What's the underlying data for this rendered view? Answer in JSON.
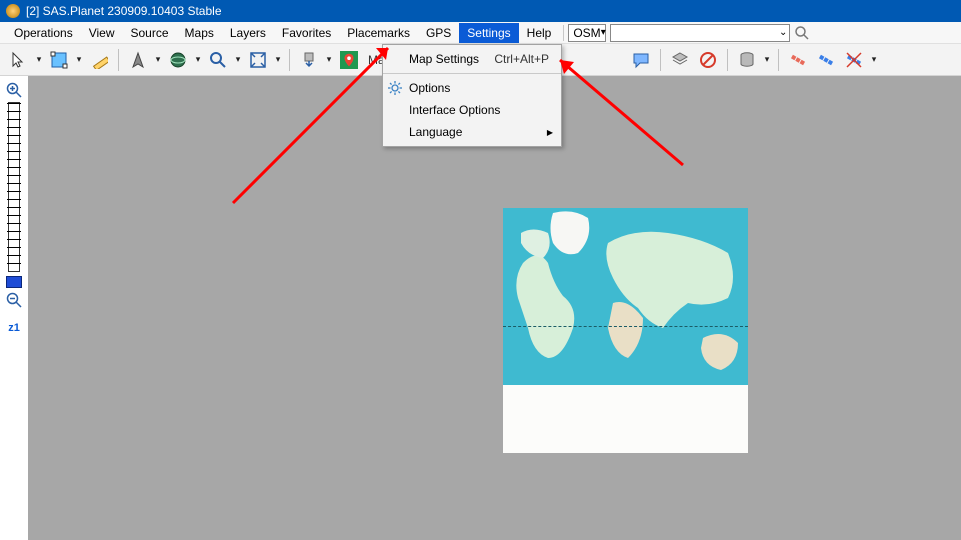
{
  "title": "[2] SAS.Planet 230909.10403 Stable",
  "menu": {
    "items": [
      "Operations",
      "View",
      "Source",
      "Maps",
      "Layers",
      "Favorites",
      "Placemarks",
      "GPS",
      "Settings",
      "Help"
    ],
    "active_index": 8,
    "osm_label": "OSM",
    "combo_text": ""
  },
  "toolbar": {
    "map_label": "Map (Goog"
  },
  "dropdown": {
    "map_settings": "Map Settings",
    "map_settings_accel": "Ctrl+Alt+P",
    "options": "Options",
    "interface_options": "Interface Options",
    "language": "Language"
  },
  "left": {
    "zoom_label": "z1"
  }
}
